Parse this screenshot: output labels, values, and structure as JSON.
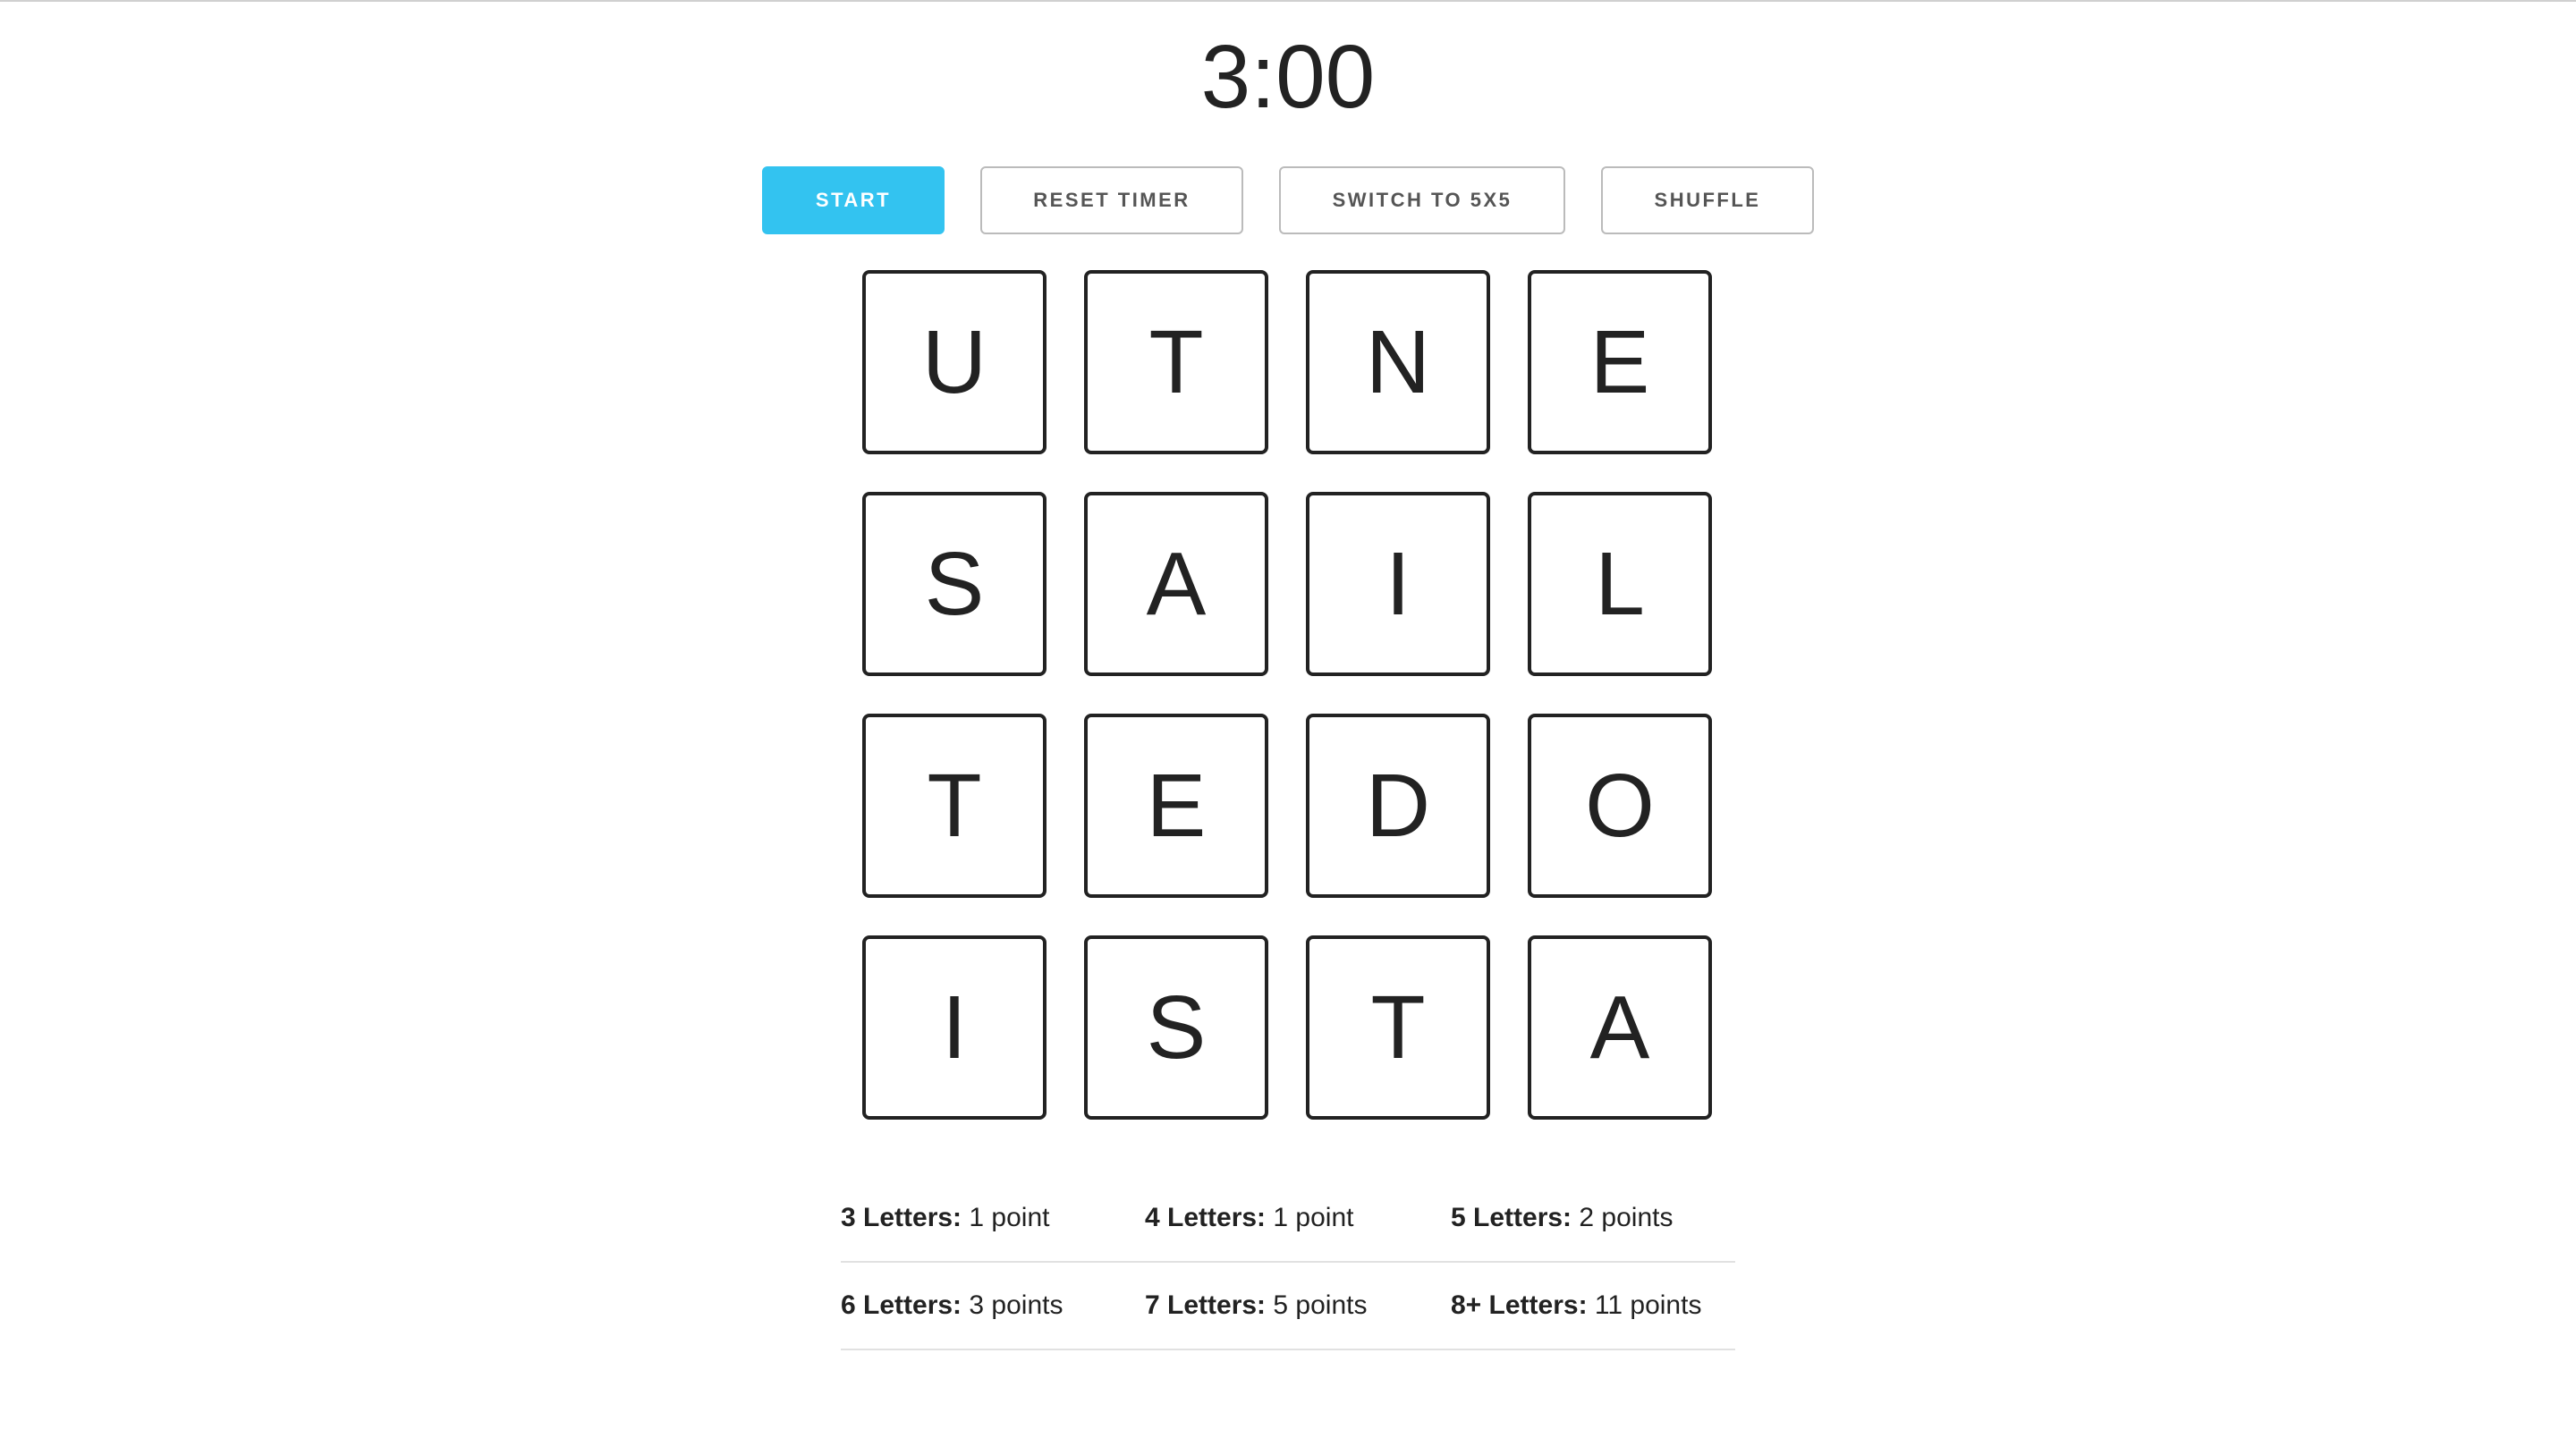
{
  "timer": {
    "display": "3:00"
  },
  "controls": {
    "start_label": "START",
    "reset_label": "RESET TIMER",
    "switch_label": "SWITCH TO 5X5",
    "shuffle_label": "SHUFFLE"
  },
  "colors": {
    "primary_button": "#33c3f0",
    "tile_border": "#222222",
    "text": "#222222"
  },
  "board": {
    "size": "4x4",
    "rows": [
      [
        "U",
        "T",
        "N",
        "E"
      ],
      [
        "S",
        "A",
        "I",
        "L"
      ],
      [
        "T",
        "E",
        "D",
        "O"
      ],
      [
        "I",
        "S",
        "T",
        "A"
      ]
    ]
  },
  "scoring": {
    "rows": [
      [
        {
          "label": "3 Letters:",
          "value": "1 point"
        },
        {
          "label": "4 Letters:",
          "value": "1 point"
        },
        {
          "label": "5 Letters:",
          "value": "2 points"
        }
      ],
      [
        {
          "label": "6 Letters:",
          "value": "3 points"
        },
        {
          "label": "7 Letters:",
          "value": "5 points"
        },
        {
          "label": "8+ Letters:",
          "value": "11 points"
        }
      ]
    ]
  }
}
